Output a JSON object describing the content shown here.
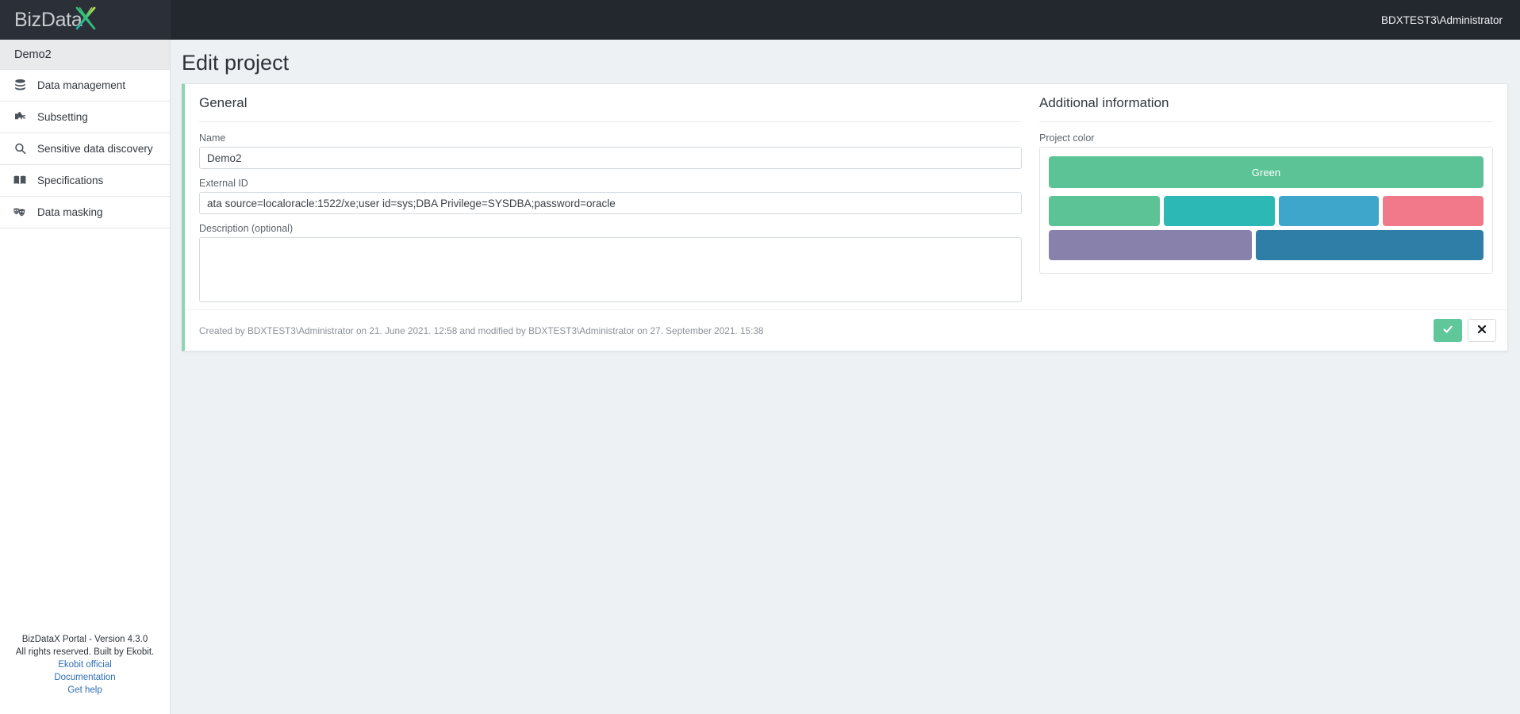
{
  "topbar": {
    "logo_text": "BizData",
    "logo_x_icon": "logo-x-icon",
    "user": "BDXTEST3\\Administrator"
  },
  "sidebar": {
    "project_name": "Demo2",
    "items": [
      {
        "label": "Data management",
        "icon": "database-icon"
      },
      {
        "label": "Subsetting",
        "icon": "puzzle-piece-icon"
      },
      {
        "label": "Sensitive data discovery",
        "icon": "search-icon"
      },
      {
        "label": "Specifications",
        "icon": "book-icon"
      },
      {
        "label": "Data masking",
        "icon": "theater-masks-icon"
      }
    ],
    "footer": {
      "version": "BizDataX Portal - Version 4.3.0",
      "rights": "All rights reserved. Built by Ekobit.",
      "links": [
        "Ekobit official",
        "Documentation",
        "Get help"
      ]
    }
  },
  "main": {
    "page_title": "Edit project",
    "general": {
      "section_title": "General",
      "name_label": "Name",
      "name_value": "Demo2",
      "name_placeholder": "Name",
      "external_id_label": "External ID",
      "external_id_value": "ata source=localoracle:1522/xe;user id=sys;DBA Privilege=SYSDBA;password=oracle",
      "external_id_placeholder": "External ID",
      "description_label": "Description (optional)",
      "description_value": "",
      "description_placeholder": ""
    },
    "additional": {
      "section_title": "Additional information",
      "project_color_label": "Project color",
      "selected_color_name": "Green",
      "selected_color_hex": "#5cc396",
      "palette": [
        {
          "name": "Green",
          "hex": "#5cc396",
          "span": 1
        },
        {
          "name": "Teal",
          "hex": "#2cb8b5",
          "span": 1
        },
        {
          "name": "Blue",
          "hex": "#3ea6cb",
          "span": 1
        },
        {
          "name": "Red",
          "hex": "#f2798a",
          "span": 1
        },
        {
          "name": "Purple",
          "hex": "#8781ab",
          "span": 1
        },
        {
          "name": "Dark blue",
          "hex": "#2f7ea8",
          "span": 1
        }
      ]
    },
    "footer": {
      "meta": "Created by BDXTEST3\\Administrator on 21. June 2021. 12:58 and modified by BDXTEST3\\Administrator on 27. September 2021. 15:38",
      "confirm_icon": "check-icon",
      "cancel_icon": "close-icon"
    }
  }
}
